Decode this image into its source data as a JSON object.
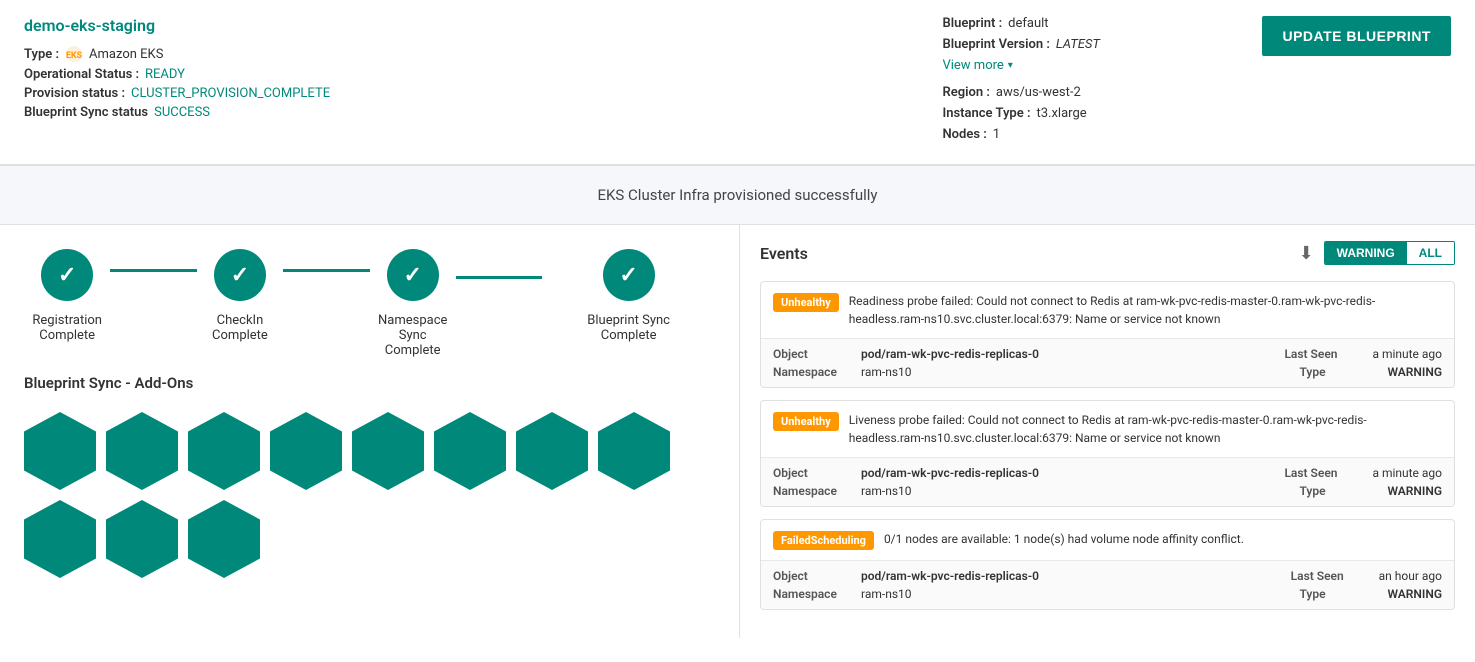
{
  "header": {
    "cluster_name": "demo-eks-staging",
    "type_label": "Type :",
    "type_icon": "amazon-eks-icon",
    "type_value": "Amazon EKS",
    "operational_label": "Operational Status :",
    "operational_value": "READY",
    "provision_label": "Provision status :",
    "provision_value": "CLUSTER_PROVISION_COMPLETE",
    "blueprint_sync_label": "Blueprint Sync status",
    "blueprint_sync_value": "SUCCESS",
    "blueprint_label": "Blueprint :",
    "blueprint_value": "default",
    "blueprint_version_label": "Blueprint Version :",
    "blueprint_version_value": "LATEST",
    "view_more_label": "View more",
    "region_label": "Region :",
    "region_value": "aws/us-west-2",
    "instance_type_label": "Instance Type :",
    "instance_type_value": "t3.xlarge",
    "nodes_label": "Nodes :",
    "nodes_value": "1",
    "update_button_label": "UPDATE BLUEPRINT"
  },
  "banner": {
    "text": "EKS Cluster Infra provisioned successfully"
  },
  "steps": [
    {
      "label": "Registration Complete",
      "completed": true
    },
    {
      "label": "CheckIn Complete",
      "completed": true
    },
    {
      "label": "Namespace Sync Complete",
      "completed": true
    },
    {
      "label": "Blueprint Sync Complete",
      "completed": true
    }
  ],
  "addons": {
    "title": "Blueprint Sync - Add-Ons",
    "count": 11
  },
  "events": {
    "title": "Events",
    "filter_warning": "WARNING",
    "filter_all": "ALL",
    "items": [
      {
        "badge": "Unhealthy",
        "badge_type": "unhealthy",
        "message": "Readiness probe failed: Could not connect to Redis at ram-wk-pvc-redis-master-0.ram-wk-pvc-redis-headless.ram-ns10.svc.cluster.local:6379: Name or service not known",
        "object_label": "Object",
        "object_value": "pod/ram-wk-pvc-redis-replicas-0",
        "namespace_label": "Namespace",
        "namespace_value": "ram-ns10",
        "last_seen_label": "Last Seen",
        "last_seen_value": "a minute ago",
        "type_label": "Type",
        "type_value": "WARNING"
      },
      {
        "badge": "Unhealthy",
        "badge_type": "unhealthy",
        "message": "Liveness probe failed: Could not connect to Redis at ram-wk-pvc-redis-master-0.ram-wk-pvc-redis-headless.ram-ns10.svc.cluster.local:6379: Name or service not known",
        "object_label": "Object",
        "object_value": "pod/ram-wk-pvc-redis-replicas-0",
        "namespace_label": "Namespace",
        "namespace_value": "ram-ns10",
        "last_seen_label": "Last Seen",
        "last_seen_value": "a minute ago",
        "type_label": "Type",
        "type_value": "WARNING"
      },
      {
        "badge": "FailedScheduling",
        "badge_type": "failed",
        "message": "0/1 nodes are available: 1 node(s) had volume node affinity conflict.",
        "object_label": "Object",
        "object_value": "pod/ram-wk-pvc-redis-replicas-0",
        "namespace_label": "Namespace",
        "namespace_value": "ram-ns10",
        "last_seen_label": "Last Seen",
        "last_seen_value": "an hour ago",
        "type_label": "Type",
        "type_value": "WARNING"
      }
    ]
  }
}
